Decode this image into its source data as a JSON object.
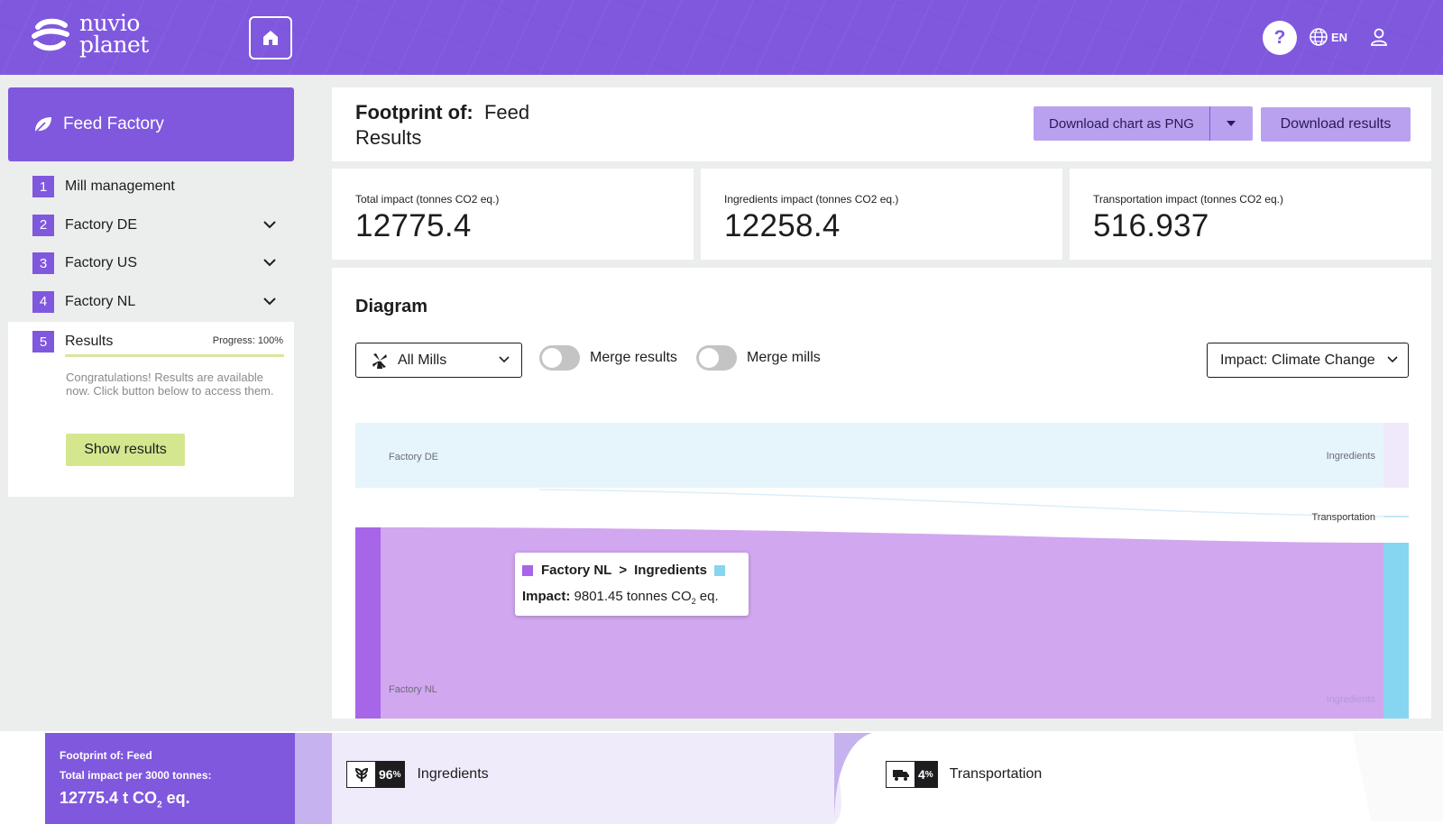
{
  "header": {
    "logo_line1": "nuvio",
    "logo_line2": "planet",
    "help_icon_text": "?",
    "language": "EN"
  },
  "sidebar": {
    "project_name": "Feed Factory",
    "steps": [
      {
        "num": "1",
        "label": "Mill management"
      },
      {
        "num": "2",
        "label": "Factory DE"
      },
      {
        "num": "3",
        "label": "Factory US"
      },
      {
        "num": "4",
        "label": "Factory NL"
      },
      {
        "num": "5",
        "label": "Results"
      }
    ],
    "progress_text": "Progress: 100%",
    "progress_value": 1.0,
    "congrats_text": "Congratulations! Results are available now. Click button below to access them.",
    "show_results_label": "Show results"
  },
  "title_panel": {
    "prefix": "Footprint of:",
    "name": "Feed",
    "line2": "Results",
    "download_png_label": "Download chart as PNG",
    "download_results_label": "Download results"
  },
  "stats": [
    {
      "label": "Total impact (tonnes CO2 eq.)",
      "value": "12775.4"
    },
    {
      "label": "Ingredients impact (tonnes CO2 eq.)",
      "value": "12258.4"
    },
    {
      "label": "Transportation impact (tonnes CO2 eq.)",
      "value": "516.937"
    }
  ],
  "diagram": {
    "title": "Diagram",
    "mill_select": "All Mills",
    "merge_results_label": "Merge results",
    "merge_mills_label": "Merge mills",
    "merge_results_on": false,
    "merge_mills_on": false,
    "impact_select": "Impact: Climate Change",
    "sankey_labels": {
      "factory_de": "Factory DE",
      "ingredients_top": "Ingredients",
      "transportation": "Transportation",
      "factory_nl": "Factory NL",
      "ingredients_bottom": "Ingredients"
    },
    "colors": {
      "factory_de": "#e6f4fb",
      "factory_nl": "#d1a7ef",
      "factory_nl_node": "#a765e8",
      "transport_node": "#86d6f2",
      "ingredients_node": "#efe9fb"
    },
    "tooltip": {
      "source": "Factory NL",
      "arrow": ">",
      "target": "Ingredients",
      "impact_label": "Impact:",
      "impact_value": "9801.45 tonnes CO",
      "impact_sub": "2",
      "impact_unit": " eq.",
      "source_color": "#a765e8",
      "target_color": "#86d6f2"
    }
  },
  "footer": {
    "fp_line1": "Footprint of:  Feed",
    "fp_line2": "Total impact per 3000 tonnes:",
    "fp_value": "12775.4 t CO",
    "fp_sub": "2",
    "fp_unit": " eq.",
    "categories": [
      {
        "pct": "96",
        "pct_unit": "%",
        "label": "Ingredients",
        "icon": "plant-icon"
      },
      {
        "pct": "4",
        "pct_unit": "%",
        "label": "Transportation",
        "icon": "truck-icon"
      }
    ]
  }
}
